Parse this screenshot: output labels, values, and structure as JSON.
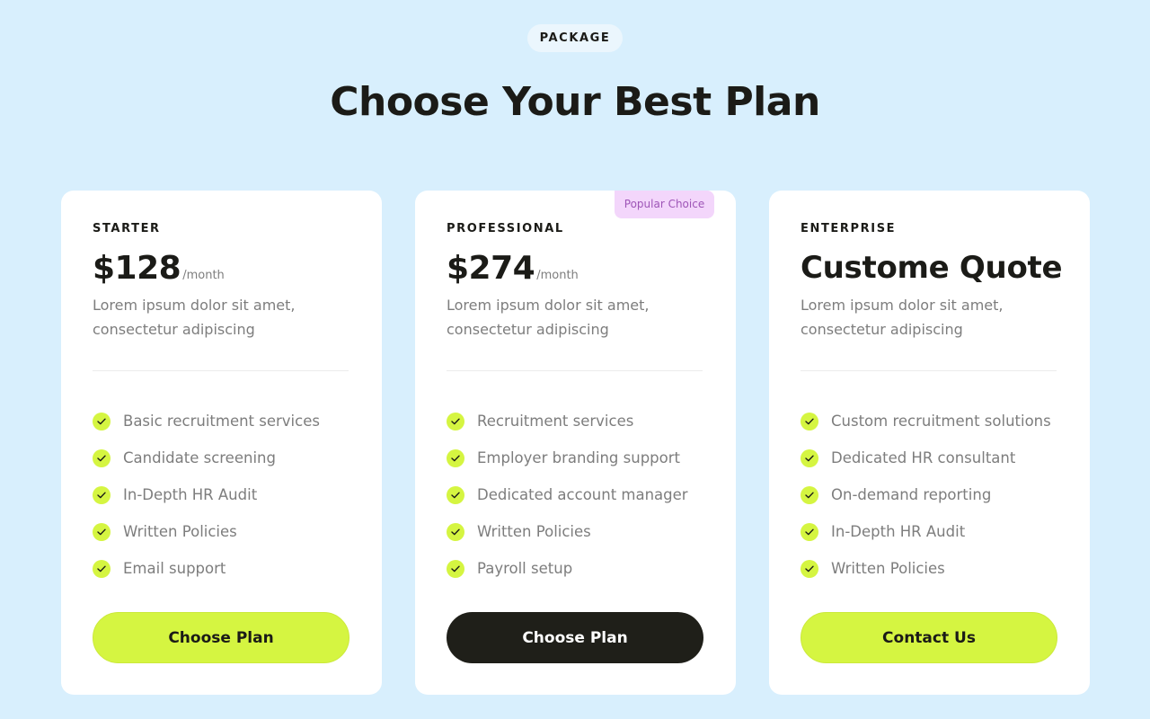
{
  "header": {
    "badge": "PACKAGE",
    "title": "Choose Your Best Plan"
  },
  "colors": {
    "background": "#d8effd",
    "accent": "#d5f541",
    "dark_button": "#1f1f19",
    "popular_badge_bg": "#f3d6fb",
    "popular_badge_text": "#9e55b7"
  },
  "plans": [
    {
      "tier": "STARTER",
      "price": "$128",
      "period": "/month",
      "description": "Lorem ipsum dolor sit amet, consectetur adipiscing",
      "features": [
        "Basic recruitment services",
        "Candidate screening",
        "In-Depth HR Audit",
        "Written Policies",
        "Email support"
      ],
      "button": "Choose Plan"
    },
    {
      "tier": "PROFESSIONAL",
      "badge": "Popular Choice",
      "price": "$274",
      "period": "/month",
      "description": "Lorem ipsum dolor sit amet, consectetur adipiscing",
      "features": [
        "Recruitment services",
        "Employer branding support",
        "Dedicated account manager",
        "Written Policies",
        "Payroll setup"
      ],
      "button": "Choose Plan"
    },
    {
      "tier": "ENTERPRISE",
      "price": "Custome Quote",
      "description": "Lorem ipsum dolor sit amet, consectetur adipiscing",
      "features": [
        "Custom recruitment solutions",
        "Dedicated HR consultant",
        "On-demand reporting",
        "In-Depth HR Audit",
        "Written Policies"
      ],
      "button": "Contact Us"
    }
  ],
  "icons": {
    "feature_check": "check-icon"
  }
}
